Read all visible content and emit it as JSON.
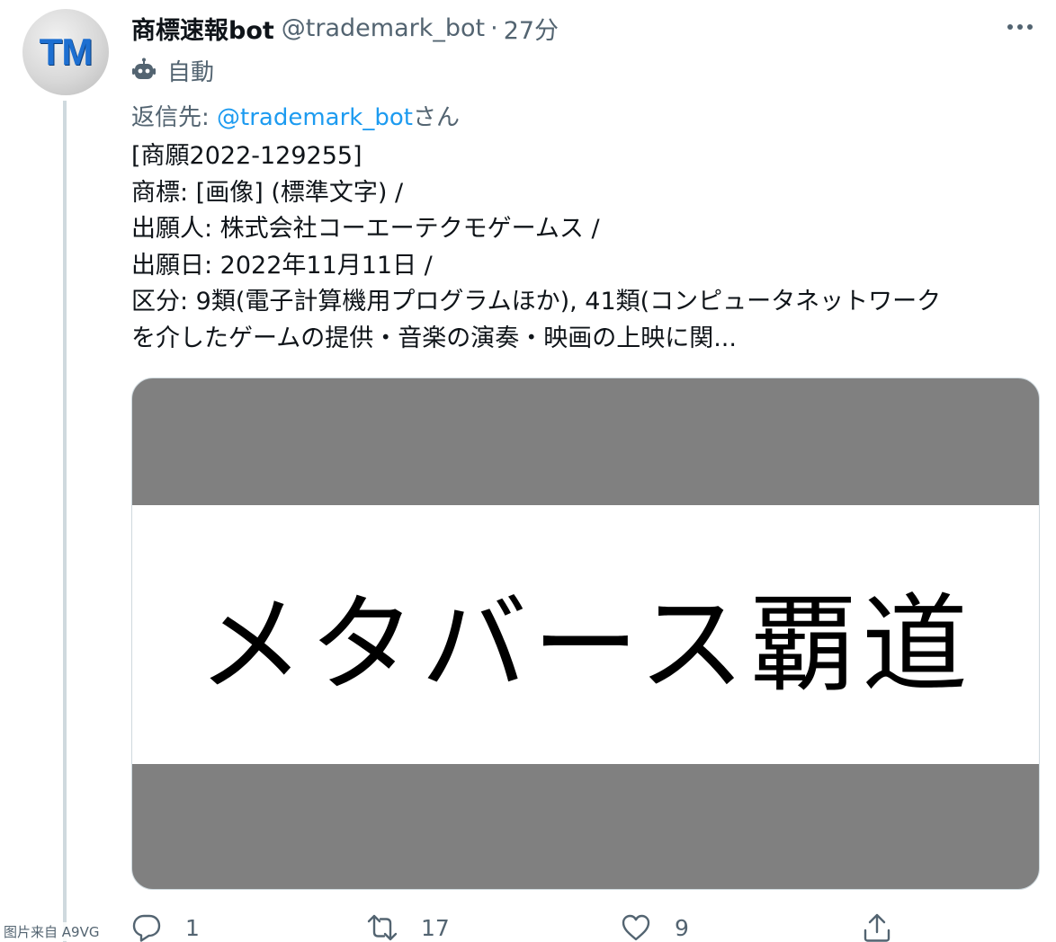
{
  "avatar": {
    "text": "TM"
  },
  "header": {
    "name": "商標速報bot",
    "handle": "@trademark_bot",
    "separator": "·",
    "time": "27分"
  },
  "automated": {
    "icon": "robot-icon",
    "label": "自動"
  },
  "reply": {
    "prefix": "返信先: ",
    "mention": "@trademark_bot",
    "suffix": "さん"
  },
  "tweet": {
    "lines": [
      "[商願2022-129255]",
      "商標: [画像] (標準文字) /",
      "出願人: 株式会社コーエーテクモゲームス /",
      "出願日: 2022年11月11日 /",
      "区分: 9類(電子計算機用プログラムほか), 41類(コンピュータネットワーク",
      "を介したゲームの提供・音楽の演奏・映画の上映に関..."
    ]
  },
  "media": {
    "image_text": "メタバース覇道",
    "border_color": "#808080"
  },
  "actions": {
    "reply_count": "1",
    "retweet_count": "17",
    "like_count": "9"
  },
  "watermark": "图片来自 A9VG",
  "colors": {
    "muted": "#536471",
    "link": "#1d9bf0",
    "text": "#0f1419",
    "thread_line": "#cfd9de"
  }
}
